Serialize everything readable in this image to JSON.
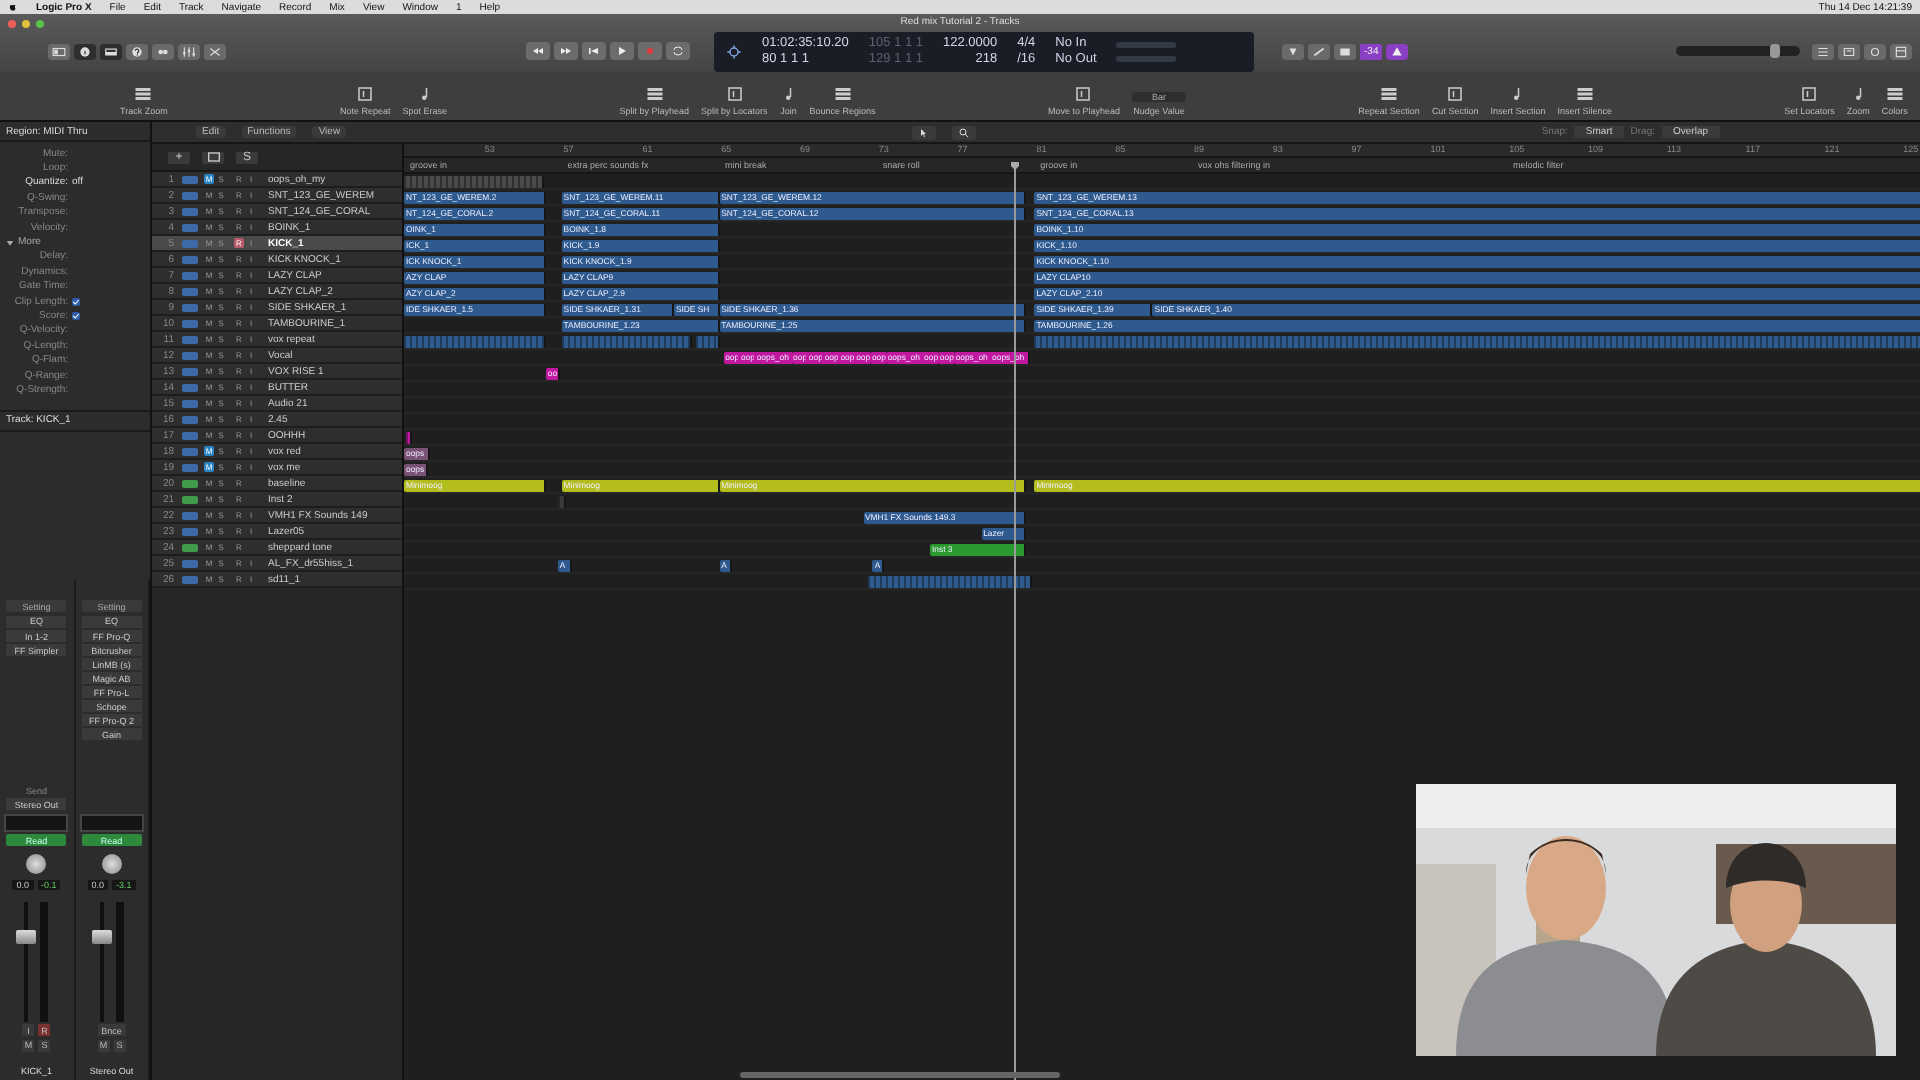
{
  "menubar": {
    "app": "Logic Pro X",
    "menus": [
      "File",
      "Edit",
      "Track",
      "Navigate",
      "Record",
      "Mix",
      "View",
      "Window",
      "1",
      "Help"
    ],
    "clock": "Thu 14 Dec  14:21:39"
  },
  "window": {
    "title": "Red mix Tutorial 2 - Tracks"
  },
  "lcd": {
    "time": "01:02:35:10.20",
    "position": "80   1   1      1",
    "left_locator": "105   1   1   1",
    "right_locator": "129   1   1   1",
    "tempo": "122.0000",
    "value": "218",
    "signature": "4/4",
    "division": "/16",
    "input": "No In",
    "output": "No Out"
  },
  "count_badge": "-34",
  "volume": {
    "level": 0.8
  },
  "tools": [
    {
      "label": "Track Zoom"
    },
    {
      "label": "Note Repeat"
    },
    {
      "label": "Spot Erase"
    },
    {
      "label": "Split by Playhead"
    },
    {
      "label": "Split by Locators"
    },
    {
      "label": "Join"
    },
    {
      "label": "Bounce Regions"
    },
    {
      "label": "Move to Playhead"
    },
    {
      "label": "Nudge Value",
      "value": "Bar"
    },
    {
      "label": "Repeat Section"
    },
    {
      "label": "Cut Section"
    },
    {
      "label": "Insert Section"
    },
    {
      "label": "Insert Silence"
    },
    {
      "label": "Set Locators"
    },
    {
      "label": "Zoom"
    },
    {
      "label": "Colors"
    }
  ],
  "inspector": {
    "region": "Region: MIDI Thru",
    "params": [
      {
        "kind": "param",
        "label": "Mute:"
      },
      {
        "kind": "param",
        "label": "Loop:"
      },
      {
        "kind": "param",
        "label": "Quantize:",
        "value": "off",
        "changed": true
      },
      {
        "kind": "param",
        "label": "Q-Swing:"
      },
      {
        "kind": "param",
        "label": "Transpose:"
      },
      {
        "kind": "param",
        "label": "Velocity:"
      },
      {
        "kind": "section",
        "label": "More",
        "expanded": true
      },
      {
        "kind": "param",
        "label": "Delay:"
      },
      {
        "kind": "param",
        "label": "Dynamics:"
      },
      {
        "kind": "param",
        "label": "Gate Time:"
      },
      {
        "kind": "check",
        "label": "Clip Length:",
        "checked": true
      },
      {
        "kind": "check",
        "label": "Score:",
        "checked": true
      },
      {
        "kind": "param",
        "label": "Q-Velocity:"
      },
      {
        "kind": "param",
        "label": "Q-Length:"
      },
      {
        "kind": "param",
        "label": "Q-Flam:"
      },
      {
        "kind": "param",
        "label": "Q-Range:"
      },
      {
        "kind": "param",
        "label": "Q-Strength:"
      }
    ],
    "track": "Track:  KICK_1"
  },
  "channel_strips": [
    {
      "setting": "Setting",
      "eq": "EQ",
      "input": "In 1-2",
      "plugins": [
        "FF Simpler"
      ],
      "send": "Send",
      "output": "Stereo Out",
      "automation": "Read",
      "pan": "0.0",
      "peak": "-0.1",
      "meter_buttons": [
        "I",
        "R"
      ],
      "mute": "M",
      "solo": "S",
      "name": "KICK_1"
    },
    {
      "setting": "Setting",
      "eq": "EQ",
      "plugins": [
        "FF Pro-Q",
        "Bitcrusher",
        "LinMB (s)",
        "Magic AB",
        "FF Pro-L",
        "Schope",
        "FF Pro-Q 2",
        "Gain"
      ],
      "automation": "Read",
      "pan": "0.0",
      "peak": "-3.1",
      "bounce": "Bnce",
      "mute": "M",
      "solo": "S",
      "name": "Stereo Out"
    }
  ],
  "track_list": {
    "menus": [
      "Edit",
      "Functions",
      "View"
    ],
    "add": "+",
    "solo_header": "S"
  },
  "arrange": {
    "snap_label": "Snap:",
    "snap": "Smart",
    "drag_label": "Drag:",
    "drag": "Overlap",
    "ruler": [
      "53",
      "57",
      "61",
      "65",
      "69",
      "73",
      "77",
      "81",
      "85",
      "89",
      "93",
      "97",
      "101",
      "105",
      "109",
      "113",
      "117",
      "121",
      "125"
    ],
    "markers": [
      "groove in",
      "extra perc sounds fx",
      "mini break",
      "snare roll",
      "groove in",
      "vox ohs filtering in",
      "melodic filter"
    ]
  },
  "tracks": [
    {
      "number": "1",
      "name": "oops_oh_my",
      "kind": "audio",
      "selected": false,
      "buttons": [
        {
          "label": "M",
          "on": true
        },
        {
          "label": "S",
          "on": false
        },
        {
          "label": "R",
          "on": false
        },
        {
          "label": "I",
          "on": false
        }
      ],
      "regions": [
        {
          "color": "#4a4a4a"
        }
      ]
    },
    {
      "number": "2",
      "name": "SNT_123_GE_WEREM",
      "kind": "audio",
      "selected": false,
      "buttons": [
        {
          "label": "M",
          "on": false
        },
        {
          "label": "S",
          "on": false
        },
        {
          "label": "R",
          "on": false
        },
        {
          "label": "I",
          "on": false
        }
      ],
      "regions": [
        {
          "name": "NT_123_GE_WEREM.2",
          "color": "#2e5a8e"
        },
        {
          "name": "SNT_123_GE_WEREM.11",
          "color": "#2e5a8e"
        },
        {
          "name": "SNT_123_GE_WEREM.12",
          "color": "#2e5a8e"
        },
        {
          "name": "SNT_123_GE_WEREM.13",
          "color": "#2e5a8e"
        }
      ]
    },
    {
      "number": "3",
      "name": "SNT_124_GE_CORAL",
      "kind": "audio",
      "selected": false,
      "buttons": [
        {
          "label": "M",
          "on": false
        },
        {
          "label": "S",
          "on": false
        },
        {
          "label": "R",
          "on": false
        },
        {
          "label": "I",
          "on": false
        }
      ],
      "regions": [
        {
          "name": "NT_124_GE_CORAL.2",
          "color": "#2e5a8e"
        },
        {
          "name": "SNT_124_GE_CORAL.11",
          "color": "#2e5a8e"
        },
        {
          "name": "SNT_124_GE_CORAL.12",
          "color": "#2e5a8e"
        },
        {
          "name": "SNT_124_GE_CORAL.13",
          "color": "#2e5a8e"
        }
      ]
    },
    {
      "number": "4",
      "name": "BOINK_1",
      "kind": "audio",
      "selected": false,
      "buttons": [
        {
          "label": "M",
          "on": false
        },
        {
          "label": "S",
          "on": false
        },
        {
          "label": "R",
          "on": false
        },
        {
          "label": "I",
          "on": false
        }
      ],
      "regions": [
        {
          "name": "OINK_1",
          "color": "#2e5a8e"
        },
        {
          "name": "BOINK_1.8",
          "color": "#2e5a8e"
        },
        {
          "name": "BOINK_1.10",
          "color": "#2e5a8e"
        }
      ]
    },
    {
      "number": "5",
      "name": "KICK_1",
      "kind": "audio",
      "selected": true,
      "buttons": [
        {
          "label": "M",
          "on": false
        },
        {
          "label": "S",
          "on": false
        },
        {
          "label": "R",
          "on": true
        },
        {
          "label": "I",
          "on": false
        }
      ],
      "regions": [
        {
          "name": "ICK_1",
          "color": "#2e5a8e"
        },
        {
          "name": "KICK_1.9",
          "color": "#2e5a8e"
        },
        {
          "name": "KICK_1.10",
          "color": "#2e5a8e"
        }
      ]
    },
    {
      "number": "6",
      "name": "KICK KNOCK_1",
      "kind": "audio",
      "selected": false,
      "buttons": [
        {
          "label": "M",
          "on": false
        },
        {
          "label": "S",
          "on": false
        },
        {
          "label": "R",
          "on": false
        },
        {
          "label": "I",
          "on": false
        }
      ],
      "regions": [
        {
          "name": "ICK KNOCK_1",
          "color": "#2e5a8e"
        },
        {
          "name": "KICK KNOCK_1.9",
          "color": "#2e5a8e"
        },
        {
          "name": "KICK KNOCK_1.10",
          "color": "#2e5a8e"
        }
      ]
    },
    {
      "number": "7",
      "name": "LAZY CLAP",
      "kind": "audio",
      "selected": false,
      "buttons": [
        {
          "label": "M",
          "on": false
        },
        {
          "label": "S",
          "on": false
        },
        {
          "label": "R",
          "on": false
        },
        {
          "label": "I",
          "on": false
        }
      ],
      "regions": [
        {
          "name": "AZY CLAP",
          "color": "#2e5a8e"
        },
        {
          "name": "LAZY CLAP9",
          "color": "#2e5a8e"
        },
        {
          "name": "LAZY CLAP10",
          "color": "#2e5a8e"
        }
      ]
    },
    {
      "number": "8",
      "name": "LAZY CLAP_2",
      "kind": "audio",
      "selected": false,
      "buttons": [
        {
          "label": "M",
          "on": false
        },
        {
          "label": "S",
          "on": false
        },
        {
          "label": "R",
          "on": false
        },
        {
          "label": "I",
          "on": false
        }
      ],
      "regions": [
        {
          "name": "AZY CLAP_2",
          "color": "#2e5a8e"
        },
        {
          "name": "LAZY CLAP_2.9",
          "color": "#2e5a8e"
        },
        {
          "name": "LAZY CLAP_2.10",
          "color": "#2e5a8e"
        }
      ]
    },
    {
      "number": "9",
      "name": "SIDE SHKAER_1",
      "kind": "audio",
      "selected": false,
      "buttons": [
        {
          "label": "M",
          "on": false
        },
        {
          "label": "S",
          "on": false
        },
        {
          "label": "R",
          "on": false
        },
        {
          "label": "I",
          "on": false
        }
      ],
      "regions": [
        {
          "name": "IDE SHKAER_1.5",
          "color": "#2e5a8e"
        },
        {
          "name": "SIDE SHKAER_1.31",
          "color": "#2e5a8e"
        },
        {
          "name": "SIDE SH",
          "color": "#2e5a8e"
        },
        {
          "name": "SIDE SHKAER_1.36",
          "color": "#2e5a8e"
        },
        {
          "name": "SIDE SHKAER_1.39",
          "color": "#2e5a8e"
        },
        {
          "name": "SIDE SHKAER_1.40",
          "color": "#2e5a8e"
        }
      ]
    },
    {
      "number": "10",
      "name": "TAMBOURINE_1",
      "kind": "audio",
      "selected": false,
      "buttons": [
        {
          "label": "M",
          "on": false
        },
        {
          "label": "S",
          "on": false
        },
        {
          "label": "R",
          "on": false
        },
        {
          "label": "I",
          "on": false
        }
      ],
      "regions": [
        {
          "name": "TAMBOURINE_1.23",
          "color": "#2e5a8e"
        },
        {
          "name": "TAMBOURINE_1.25",
          "color": "#2e5a8e"
        },
        {
          "name": "TAMBOURINE_1.26",
          "color": "#2e5a8e"
        }
      ]
    },
    {
      "number": "11",
      "name": "vox repeat",
      "kind": "audio",
      "selected": false,
      "buttons": [
        {
          "label": "M",
          "on": false
        },
        {
          "label": "S",
          "on": false
        },
        {
          "label": "R",
          "on": false
        },
        {
          "label": "I",
          "on": false
        }
      ],
      "regions": [
        {
          "color": "#2e5a8e"
        },
        {
          "color": "#2e5a8e"
        },
        {
          "color": "#2e5a8e"
        },
        {
          "color": "#2e5a8e"
        }
      ]
    },
    {
      "number": "12",
      "name": "Vocal",
      "kind": "audio",
      "selected": false,
      "buttons": [
        {
          "label": "M",
          "on": false
        },
        {
          "label": "S",
          "on": false
        },
        {
          "label": "R",
          "on": false
        },
        {
          "label": "I",
          "on": false
        }
      ],
      "regions": [
        {
          "name": "oop",
          "color": "#c0189f"
        },
        {
          "name": "oop",
          "color": "#c0189f"
        },
        {
          "name": "oops_oh",
          "color": "#c0189f"
        },
        {
          "name": "oop",
          "color": "#c0189f"
        },
        {
          "name": "oop",
          "color": "#c0189f"
        },
        {
          "name": "oop",
          "color": "#c0189f"
        },
        {
          "name": "oop",
          "color": "#c0189f"
        },
        {
          "name": "oop",
          "color": "#c0189f"
        },
        {
          "name": "oop",
          "color": "#c0189f"
        },
        {
          "name": "oops_oh",
          "color": "#c0189f"
        },
        {
          "name": "oop",
          "color": "#c0189f"
        },
        {
          "name": "oop",
          "color": "#c0189f"
        },
        {
          "name": "oops_oh",
          "color": "#c0189f"
        },
        {
          "name": "oops_oh",
          "color": "#c0189f"
        }
      ]
    },
    {
      "number": "13",
      "name": "VOX RISE 1",
      "kind": "audio",
      "selected": false,
      "buttons": [
        {
          "label": "M",
          "on": false
        },
        {
          "label": "S",
          "on": false
        },
        {
          "label": "R",
          "on": false
        },
        {
          "label": "I",
          "on": false
        }
      ],
      "regions": [
        {
          "name": "oo",
          "color": "#c0189f"
        }
      ]
    },
    {
      "number": "14",
      "name": "BUTTER",
      "kind": "audio",
      "selected": false,
      "buttons": [
        {
          "label": "M",
          "on": false
        },
        {
          "label": "S",
          "on": false
        },
        {
          "label": "R",
          "on": false
        },
        {
          "label": "I",
          "on": false
        }
      ]
    },
    {
      "number": "15",
      "name": "Audio 21",
      "kind": "audio",
      "selected": false,
      "buttons": [
        {
          "label": "M",
          "on": false
        },
        {
          "label": "S",
          "on": false
        },
        {
          "label": "R",
          "on": false
        },
        {
          "label": "I",
          "on": false
        }
      ]
    },
    {
      "number": "16",
      "name": "2.45",
      "kind": "audio",
      "selected": false,
      "buttons": [
        {
          "label": "M",
          "on": false
        },
        {
          "label": "S",
          "on": false
        },
        {
          "label": "R",
          "on": false
        },
        {
          "label": "I",
          "on": false
        }
      ]
    },
    {
      "number": "17",
      "name": "OOHHH",
      "kind": "audio",
      "selected": false,
      "buttons": [
        {
          "label": "M",
          "on": false
        },
        {
          "label": "S",
          "on": false
        },
        {
          "label": "R",
          "on": false
        },
        {
          "label": "I",
          "on": false
        }
      ],
      "regions": [
        {
          "color": "#c0189f"
        }
      ]
    },
    {
      "number": "18",
      "name": "vox red",
      "kind": "audio",
      "selected": false,
      "buttons": [
        {
          "label": "M",
          "on": true
        },
        {
          "label": "S",
          "on": false
        },
        {
          "label": "R",
          "on": false
        },
        {
          "label": "I",
          "on": false
        }
      ],
      "regions": [
        {
          "name": "oops",
          "color": "#7a5276"
        }
      ]
    },
    {
      "number": "19",
      "name": "vox me",
      "kind": "audio",
      "selected": false,
      "buttons": [
        {
          "label": "M",
          "on": true
        },
        {
          "label": "S",
          "on": false
        },
        {
          "label": "R",
          "on": false
        },
        {
          "label": "I",
          "on": false
        }
      ],
      "regions": [
        {
          "name": "oops",
          "color": "#7a5276"
        }
      ]
    },
    {
      "number": "20",
      "name": "baseline",
      "kind": "instrument",
      "selected": false,
      "buttons": [
        {
          "label": "M",
          "on": false
        },
        {
          "label": "S",
          "on": false
        },
        {
          "label": "R",
          "on": false
        }
      ],
      "regions": [
        {
          "name": "Minimoog",
          "color": "#b4bd1e"
        },
        {
          "name": "Minimoog",
          "color": "#b4bd1e"
        },
        {
          "name": "Minimoog",
          "color": "#b4bd1e"
        },
        {
          "name": "Minimoog",
          "color": "#b4bd1e"
        }
      ]
    },
    {
      "number": "21",
      "name": "Inst 2",
      "kind": "instrument",
      "selected": false,
      "buttons": [
        {
          "label": "M",
          "on": false
        },
        {
          "label": "S",
          "on": false
        },
        {
          "label": "R",
          "on": false
        }
      ],
      "regions": [
        {
          "color": "#3a3a3a"
        }
      ]
    },
    {
      "number": "22",
      "name": "VMH1 FX Sounds 149",
      "kind": "audio",
      "selected": false,
      "buttons": [
        {
          "label": "M",
          "on": false
        },
        {
          "label": "S",
          "on": false
        },
        {
          "label": "R",
          "on": false
        },
        {
          "label": "I",
          "on": false
        }
      ],
      "regions": [
        {
          "name": "VMH1 FX Sounds 149.3",
          "color": "#2e5a8e"
        }
      ]
    },
    {
      "number": "23",
      "name": "Lazer05",
      "kind": "audio",
      "selected": false,
      "buttons": [
        {
          "label": "M",
          "on": false
        },
        {
          "label": "S",
          "on": false
        },
        {
          "label": "R",
          "on": false
        },
        {
          "label": "I",
          "on": false
        }
      ],
      "regions": [
        {
          "name": "Lazer",
          "color": "#2e5a8e"
        }
      ]
    },
    {
      "number": "24",
      "name": "sheppard tone",
      "kind": "instrument",
      "selected": false,
      "buttons": [
        {
          "label": "M",
          "on": false
        },
        {
          "label": "S",
          "on": false
        },
        {
          "label": "R",
          "on": false
        }
      ],
      "regions": [
        {
          "name": "Inst 3",
          "color": "#2a9a2e"
        }
      ]
    },
    {
      "number": "25",
      "name": "AL_FX_dr55hiss_1",
      "kind": "audio",
      "selected": false,
      "buttons": [
        {
          "label": "M",
          "on": false
        },
        {
          "label": "S",
          "on": false
        },
        {
          "label": "R",
          "on": false
        },
        {
          "label": "I",
          "on": false
        }
      ],
      "regions": [
        {
          "name": "A",
          "color": "#2e5a8e"
        },
        {
          "name": "A",
          "color": "#2e5a8e"
        },
        {
          "name": "A",
          "color": "#2e5a8e"
        }
      ]
    },
    {
      "number": "26",
      "name": "sd11_1",
      "kind": "audio",
      "selected": false,
      "buttons": [
        {
          "label": "M",
          "on": false
        },
        {
          "label": "S",
          "on": false
        },
        {
          "label": "R",
          "on": false
        },
        {
          "label": "I",
          "on": false
        }
      ],
      "regions": [
        {
          "color": "#2e5a8e"
        }
      ]
    }
  ]
}
